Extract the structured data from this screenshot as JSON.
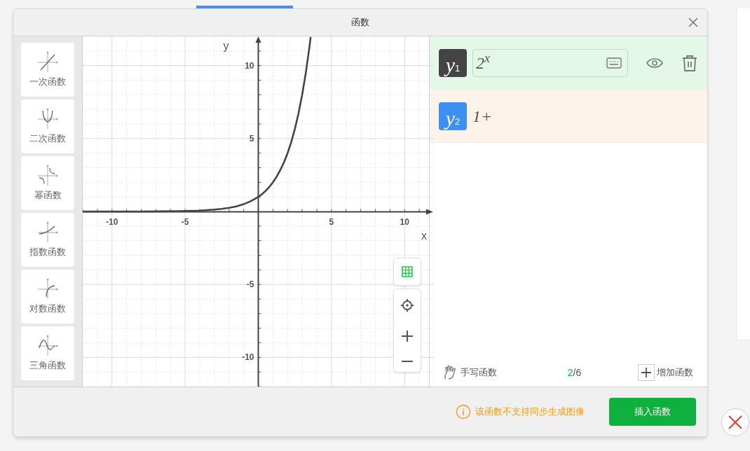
{
  "dialog": {
    "title": "函数"
  },
  "function_types": [
    {
      "label": "一次函数",
      "kind": "linear"
    },
    {
      "label": "二次函数",
      "kind": "quadratic"
    },
    {
      "label": "幂函数",
      "kind": "power"
    },
    {
      "label": "指数函数",
      "kind": "exponential"
    },
    {
      "label": "对数函数",
      "kind": "logarithmic"
    },
    {
      "label": "三角函数",
      "kind": "trigonometric"
    }
  ],
  "graph": {
    "x_axis_label": "x",
    "y_axis_label": "y",
    "chart_data": {
      "type": "line",
      "grid": true,
      "xlim": [
        -12,
        12
      ],
      "ylim": [
        -12,
        12
      ],
      "xticks": [
        -10,
        -5,
        5,
        10
      ],
      "yticks": [
        -10,
        -5,
        5,
        10
      ],
      "x": [
        -12,
        -10,
        -8,
        -6,
        -5,
        -4,
        -3,
        -2.5,
        -2,
        -1.5,
        -1,
        -0.5,
        0,
        0.25,
        0.5,
        0.75,
        1,
        1.25,
        1.5,
        1.75,
        2,
        2.25,
        2.5,
        2.75,
        3,
        3.25,
        3.5,
        3.58
      ],
      "series": [
        {
          "color": "#444444",
          "values": [
            0,
            0,
            0,
            0.02,
            0.03,
            0.06,
            0.13,
            0.18,
            0.25,
            0.35,
            0.5,
            0.71,
            1,
            1.19,
            1.41,
            1.68,
            2,
            2.38,
            2.83,
            3.36,
            4,
            4.76,
            5.66,
            6.73,
            8,
            9.51,
            11.31,
            11.96
          ]
        }
      ]
    }
  },
  "functions": [
    {
      "badge": "y",
      "index": "1",
      "color": "#444444",
      "expression": "2$^{x}$",
      "selected": true
    },
    {
      "badge": "y",
      "index": "2",
      "color": "#3b8ff5",
      "expression": "1+",
      "selected": false
    }
  ],
  "footer_bar": {
    "handwrite": "手写函数",
    "count": "2",
    "total": "/6",
    "add": "增加函数"
  },
  "warning": "该函数不支持同步生成图像",
  "insert_button": "插入函数"
}
